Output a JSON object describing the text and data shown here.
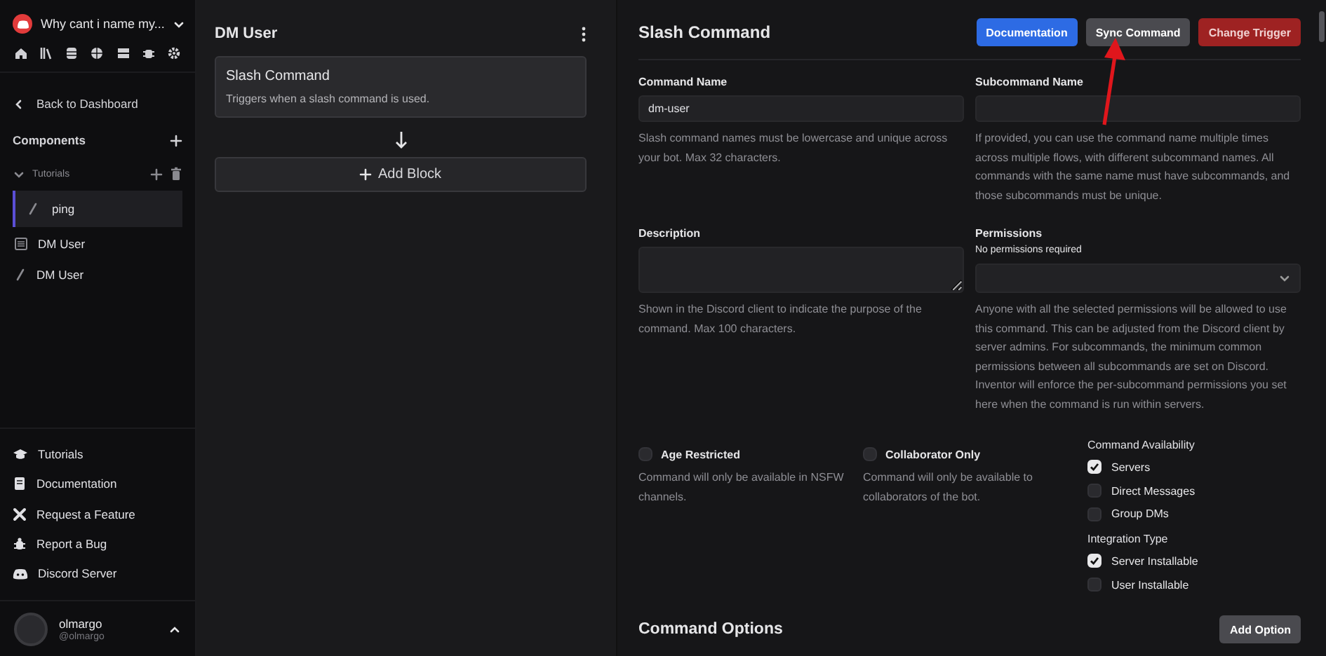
{
  "sidebar": {
    "server_name": "Why cant i name my...",
    "back_link": "Back to Dashboard",
    "components_heading": "Components",
    "folders": [
      {
        "name": "Tutorials",
        "expanded": true,
        "children": [
          {
            "name": "ping",
            "kind": "command",
            "selected": true
          }
        ]
      }
    ],
    "items": [
      {
        "name": "DM User",
        "kind": "event",
        "selected": false
      },
      {
        "name": "DM User",
        "kind": "command",
        "selected": false
      }
    ],
    "links": [
      {
        "label": "Tutorials",
        "kind": "tutorials"
      },
      {
        "label": "Documentation",
        "kind": "docs"
      },
      {
        "label": "Request a Feature",
        "kind": "feature"
      },
      {
        "label": "Report a Bug",
        "kind": "bug"
      },
      {
        "label": "Discord Server",
        "kind": "discord"
      }
    ],
    "user": {
      "name": "olmargo",
      "handle": "@olmargo"
    }
  },
  "flow": {
    "title": "DM User",
    "trigger": {
      "title": "Slash Command",
      "description": "Triggers when a slash command is used."
    },
    "add_block": "Add Block"
  },
  "command": {
    "title": "Slash Command",
    "buttons": [
      {
        "label": "Documentation",
        "kind": "primary"
      },
      {
        "label": "Sync Command",
        "kind": "secondary"
      },
      {
        "label": "Change Trigger",
        "kind": "danger"
      }
    ],
    "fields": [
      {
        "label": "Command Name",
        "kind": "input",
        "value": "dm-user",
        "help": "Slash command names must be lowercase and unique across your bot. Max 32 characters."
      },
      {
        "label": "Subcommand Name",
        "kind": "input",
        "help": "If provided, you can use the command name multiple times across multiple flows, with different subcommand names. All commands with the same name must have subcommands, and those subcommands must be unique."
      },
      {
        "label": "Description",
        "kind": "textarea",
        "help": "Shown in the Discord client to indicate the purpose of the command. Max 100 characters."
      },
      {
        "label": "Permissions",
        "kind": "select",
        "sublabel": "No permissions required",
        "help": "Anyone with all the selected permissions will be allowed to use this command. This can be adjusted from the Discord client by server admins. For subcommands, the minimum common permissions between all subcommands are set on Discord. Inventor will enforce the per-subcommand permissions you set here when the command is run within servers."
      }
    ],
    "toggles": [
      {
        "label": "Age Restricted",
        "checked": false,
        "help": "Command will only be available in NSFW channels."
      },
      {
        "label": "Collaborator Only",
        "checked": false,
        "help": "Command will only be available to collaborators of the bot."
      }
    ],
    "groups": [
      {
        "title": "Command Availability",
        "options": [
          {
            "label": "Servers",
            "checked": true
          },
          {
            "label": "Direct Messages",
            "checked": false
          },
          {
            "label": "Group DMs",
            "checked": false
          }
        ]
      },
      {
        "title": "Integration Type",
        "options": [
          {
            "label": "Server Installable",
            "checked": true
          },
          {
            "label": "User Installable",
            "checked": false
          }
        ]
      }
    ],
    "options_title": "Command Options",
    "add_option": "Add Option"
  }
}
